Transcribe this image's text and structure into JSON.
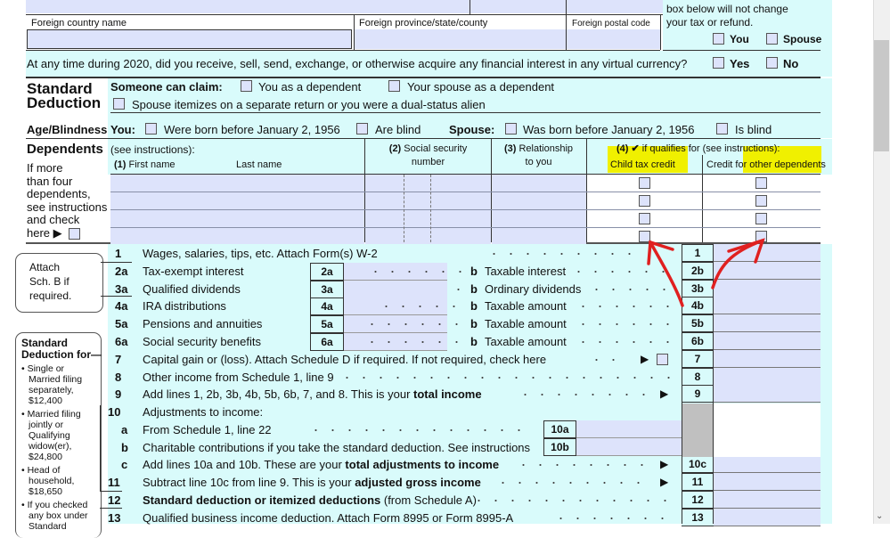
{
  "address": {
    "foreign_country_label": "Foreign country name",
    "foreign_province_label": "Foreign province/state/county",
    "foreign_postal_label": "Foreign postal code",
    "election_note_line1": "box below will not change",
    "election_note_line2": "your tax or refund.",
    "you_label": "You",
    "spouse_label": "Spouse"
  },
  "virtual_currency": {
    "question": "At any time during 2020, did you receive, sell, send, exchange, or otherwise acquire any financial interest in any virtual currency?",
    "yes_label": "Yes",
    "no_label": "No"
  },
  "standard_deduction": {
    "title_line1": "Standard",
    "title_line2": "Deduction",
    "someone_can_claim": "Someone can claim:",
    "you_dependent": "You as a dependent",
    "spouse_dependent": "Your spouse as a dependent",
    "spouse_itemizes": "Spouse itemizes on a separate return or you were a dual-status alien"
  },
  "age_blindness": {
    "title": "Age/Blindness",
    "you_label": "You:",
    "you_born": "Were born before January 2, 1956",
    "you_blind": "Are blind",
    "spouse_label": "Spouse:",
    "spouse_born": "Was born before January 2, 1956",
    "spouse_blind": "Is blind"
  },
  "dependents": {
    "title": "Dependents",
    "see_instructions": "(see instructions):",
    "side_note": [
      "If more",
      "than four",
      "dependents,",
      "see instructions",
      "and check",
      "here ▶"
    ],
    "col1_num": "(1)",
    "col1_first": "First name",
    "col1_last": "Last name",
    "col2_num": "(2)",
    "col2_line1": "Social security",
    "col2_line2": "number",
    "col3_num": "(3)",
    "col3_line1": "Relationship",
    "col3_line2": "to you",
    "col4_num": "(4) ✔",
    "col4_text": "if qualifies for (see instructions):",
    "col4a": "Child tax credit",
    "col4b": "Credit for other dependents",
    "highlight_color": "#f0f000"
  },
  "attach_note": [
    "Attach",
    "Sch. B if",
    "required."
  ],
  "sd_sidebar": {
    "title_line1": "Standard",
    "title_line2": "Deduction for—",
    "items": [
      [
        "• Single or",
        "Married filing",
        "separately,",
        "$12,400"
      ],
      [
        "• Married filing",
        "jointly or",
        "Qualifying",
        "widow(er),",
        "$24,800"
      ],
      [
        "• Head of",
        "household,",
        "$18,650"
      ],
      [
        "• If you checked",
        "any box under",
        "Standard"
      ]
    ]
  },
  "lines": {
    "l1": {
      "num": "1",
      "text": "Wages, salaries, tips, etc. Attach Form(s) W-2",
      "box": "1"
    },
    "l2": {
      "num": "2a",
      "text": "Tax-exempt interest",
      "abox": "2a",
      "b": "b",
      "btext": "Taxable interest",
      "box": "2b"
    },
    "l3": {
      "num": "3a",
      "text": "Qualified dividends",
      "abox": "3a",
      "b": "b",
      "btext": "Ordinary dividends",
      "box": "3b"
    },
    "l4": {
      "num": "4a",
      "text": "IRA distributions",
      "abox": "4a",
      "b": "b",
      "btext": "Taxable amount",
      "box": "4b"
    },
    "l5": {
      "num": "5a",
      "text": "Pensions and annuities",
      "abox": "5a",
      "b": "b",
      "btext": "Taxable amount",
      "box": "5b"
    },
    "l6": {
      "num": "6a",
      "text": "Social security benefits",
      "abox": "6a",
      "b": "b",
      "btext": "Taxable amount",
      "box": "6b"
    },
    "l7": {
      "num": "7",
      "text": "Capital gain or (loss). Attach Schedule D if required. If not required, check here",
      "box": "7"
    },
    "l8": {
      "num": "8",
      "text": "Other income from Schedule 1, line 9",
      "box": "8"
    },
    "l9": {
      "num": "9",
      "text_pre": "Add lines 1, 2b, 3b, 4b, 5b, 6b, 7, and 8. This is your ",
      "text_bold": "total income",
      "box": "9"
    },
    "l10": {
      "num": "10",
      "text": "Adjustments to income:"
    },
    "l10a": {
      "num": "a",
      "text": "From Schedule 1, line 22",
      "box": "10a"
    },
    "l10b": {
      "num": "b",
      "text": "Charitable contributions if you take the standard deduction. See instructions",
      "box": "10b"
    },
    "l10c": {
      "num": "c",
      "text_pre": "Add lines 10a and 10b. These are your ",
      "text_bold": "total adjustments to income",
      "box": "10c"
    },
    "l11": {
      "num": "11",
      "text_pre": "Subtract line 10c from line 9. This is your ",
      "text_bold": "adjusted gross income",
      "box": "11"
    },
    "l12": {
      "num": "12",
      "text_bold": "Standard deduction or itemized deductions",
      "text_post": " (from Schedule A)",
      "box": "12"
    },
    "l13": {
      "num": "13",
      "text": "Qualified business income deduction. Attach Form 8995 or Form 8995-A",
      "box": "13"
    }
  },
  "annotation": {
    "color": "#e02020",
    "description": "red hand-drawn arrows pointing from lines 1 and 6b to dependent checkboxes"
  }
}
